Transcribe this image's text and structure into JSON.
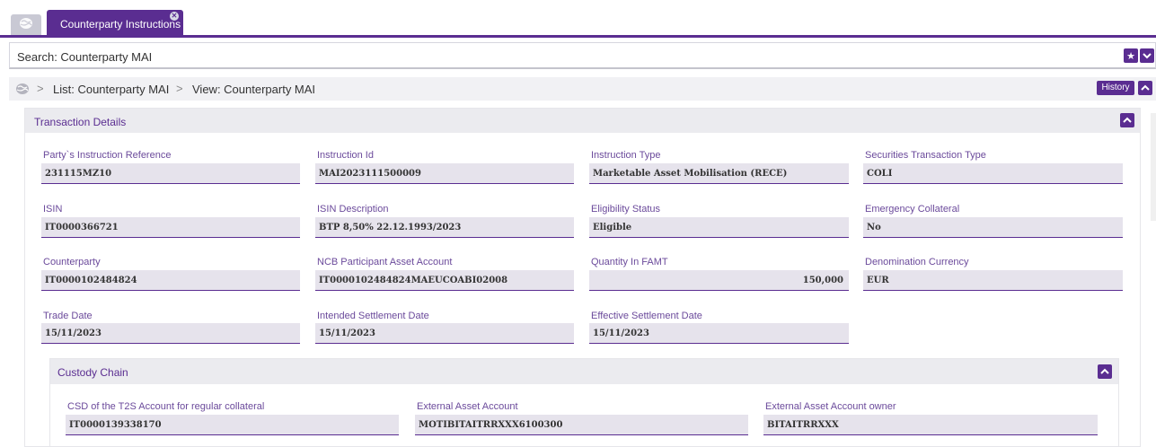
{
  "tabs": {
    "home_icon": "globe-icon",
    "active_label": "Counterparty Instructions",
    "close_icon": "close-icon"
  },
  "search": {
    "title": "Search: Counterparty MAI"
  },
  "breadcrumb": {
    "items": [
      "List: Counterparty MAI",
      "View: Counterparty MAI"
    ],
    "history_label": "History"
  },
  "transaction": {
    "title": "Transaction Details",
    "fields": [
      {
        "label": "Party`s Instruction Reference",
        "value": "231115MZ10"
      },
      {
        "label": "Instruction Id",
        "value": "MAI2023111500009"
      },
      {
        "label": "Instruction Type",
        "value": "Marketable Asset Mobilisation (RECE)"
      },
      {
        "label": "Securities Transaction Type",
        "value": "COLI"
      },
      {
        "label": "ISIN",
        "value": "IT0000366721"
      },
      {
        "label": "ISIN Description",
        "value": "BTP 8,50% 22.12.1993/2023"
      },
      {
        "label": "Eligibility Status",
        "value": "Eligible"
      },
      {
        "label": "Emergency Collateral",
        "value": "No"
      },
      {
        "label": "Counterparty",
        "value": "IT0000102484824"
      },
      {
        "label": "NCB Participant Asset Account",
        "value": "IT0000102484824MAEUCOABI02008"
      },
      {
        "label": "Quantity In FAMT",
        "value": "150,000"
      },
      {
        "label": "Denomination Currency",
        "value": "EUR"
      },
      {
        "label": "Trade Date",
        "value": "15/11/2023"
      },
      {
        "label": "Intended Settlement Date",
        "value": "15/11/2023"
      },
      {
        "label": "Effective Settlement Date",
        "value": "15/11/2023"
      }
    ]
  },
  "custody": {
    "title": "Custody Chain",
    "fields": [
      {
        "label": "CSD of the T2S Account for regular collateral",
        "value": "IT0000139338170"
      },
      {
        "label": "External Asset Account",
        "value": "MOTIBITAITRRXXX6100300"
      },
      {
        "label": "External Asset Account owner",
        "value": "BITAITRRXXX"
      }
    ]
  },
  "colors": {
    "accent": "#5a2d91",
    "field_bg": "#e6e3ec",
    "panel_head": "#ebebef"
  }
}
